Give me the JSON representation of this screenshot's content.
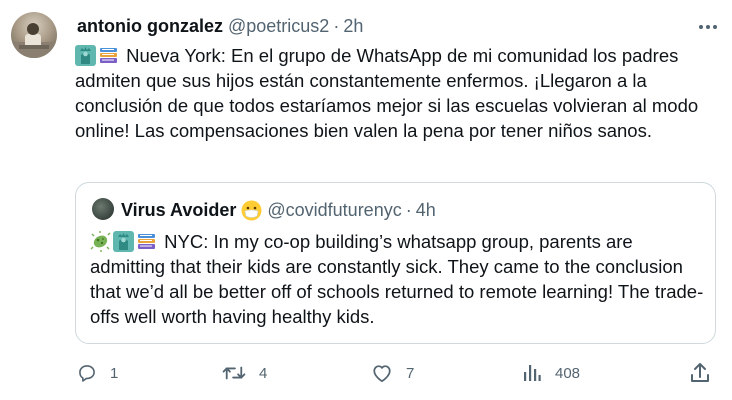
{
  "tweet": {
    "author_name": "antonio gonzalez",
    "handle": "@poetricus2",
    "separator": "·",
    "time": "2h",
    "text": "Nueva York: En el grupo de WhatsApp de mi comunidad los padres admiten que sus hijos están constantemente enfermos. ¡Llegaron a la conclusión de que todos estaríamos mejor si las escuelas volvieran al modo online! Las compensaciones bien valen la pena por tener niños sanos."
  },
  "quoted_tweet": {
    "author_name": "Virus Avoider",
    "handle": "@covidfuturenyc",
    "separator": "·",
    "time": "4h",
    "text": "NYC: In my co-op building’s whatsapp group, parents are admitting that their kids are constantly sick. They came to the conclusion that we’d all be better off of schools returned to remote learning! The trade-offs well worth having healthy kids."
  },
  "actions": {
    "replies": "1",
    "reposts": "4",
    "likes": "7",
    "views": "408"
  },
  "colors": {
    "text": "#0f1419",
    "secondary": "#536471",
    "border": "#cfd9de"
  }
}
